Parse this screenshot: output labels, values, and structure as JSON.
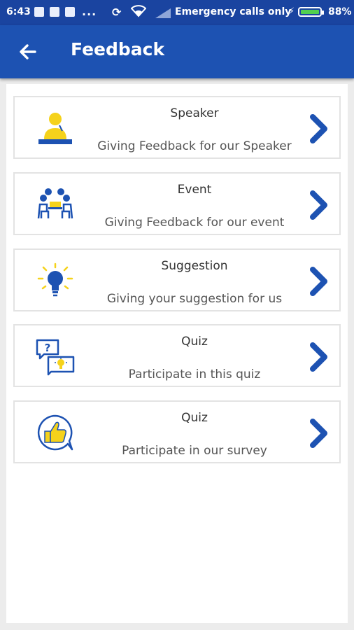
{
  "status_bar": {
    "time": "6:43",
    "overflow": "...",
    "carrier": "Emergency calls only",
    "battery": "88%"
  },
  "app_bar": {
    "back_icon": "arrow-left-icon",
    "title": "Feedback"
  },
  "colors": {
    "primary": "#1d52b2",
    "status_bar": "#1a44a0",
    "accent_yellow": "#f5d21b",
    "icon_blue": "#1d52b2",
    "battery_green": "#52d04f"
  },
  "feedback_items": [
    {
      "title": "Speaker",
      "subtitle": "Giving Feedback for our Speaker",
      "icon": "speaker-podium-icon"
    },
    {
      "title": "Event",
      "subtitle": "Giving Feedback for our event",
      "icon": "event-meeting-icon"
    },
    {
      "title": "Suggestion",
      "subtitle": "Giving your suggestion for us",
      "icon": "lightbulb-icon"
    },
    {
      "title": "Quiz",
      "subtitle": "Participate in this quiz",
      "icon": "quiz-chat-icon"
    },
    {
      "title": "Quiz",
      "subtitle": "Participate in our survey",
      "icon": "thumbs-up-icon"
    }
  ]
}
